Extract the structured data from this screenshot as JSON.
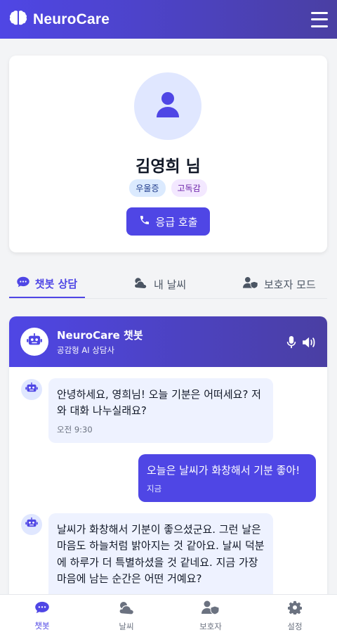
{
  "app": {
    "title": "NeuroCare"
  },
  "profile": {
    "name": "김영희 님",
    "tags": [
      "우울증",
      "고독감"
    ],
    "emergency_label": "응급 호출"
  },
  "tabs": [
    {
      "label": "챗봇 상담",
      "icon": "chat-icon",
      "active": true
    },
    {
      "label": "내 날씨",
      "icon": "weather-icon",
      "active": false
    },
    {
      "label": "보호자 모드",
      "icon": "guardian-icon",
      "active": false
    }
  ],
  "chat": {
    "title": "NeuroCare 챗봇",
    "subtitle": "공감형 AI 상담사",
    "messages": [
      {
        "from": "bot",
        "text": "안녕하세요, 영희님! 오늘 기분은 어떠세요? 저와 대화 나누실래요?",
        "time": "오전 9:30"
      },
      {
        "from": "user",
        "text": "오늘은 날씨가 화창해서 기분 좋아!",
        "time": "지금"
      },
      {
        "from": "bot",
        "text": "날씨가 화창해서 기분이 좋으셨군요. 그런 날은 마음도 하늘처럼 밝아지는 것 같아요. 날씨 덕분에 하루가 더 특별하셨을 것 같네요. 지금 가장 마음에 남는 순간은 어떤 거예요?",
        "time": ""
      }
    ]
  },
  "bottom_nav": [
    {
      "label": "챗봇",
      "icon": "chat-icon",
      "active": true
    },
    {
      "label": "날씨",
      "icon": "weather-icon",
      "active": false
    },
    {
      "label": "보호자",
      "icon": "guardian-icon",
      "active": false
    },
    {
      "label": "설정",
      "icon": "gear-icon",
      "active": false
    }
  ],
  "colors": {
    "accent": "#4f46e5",
    "accent_dark": "#4a3fa3",
    "bubble_bot": "#eef2ff"
  }
}
